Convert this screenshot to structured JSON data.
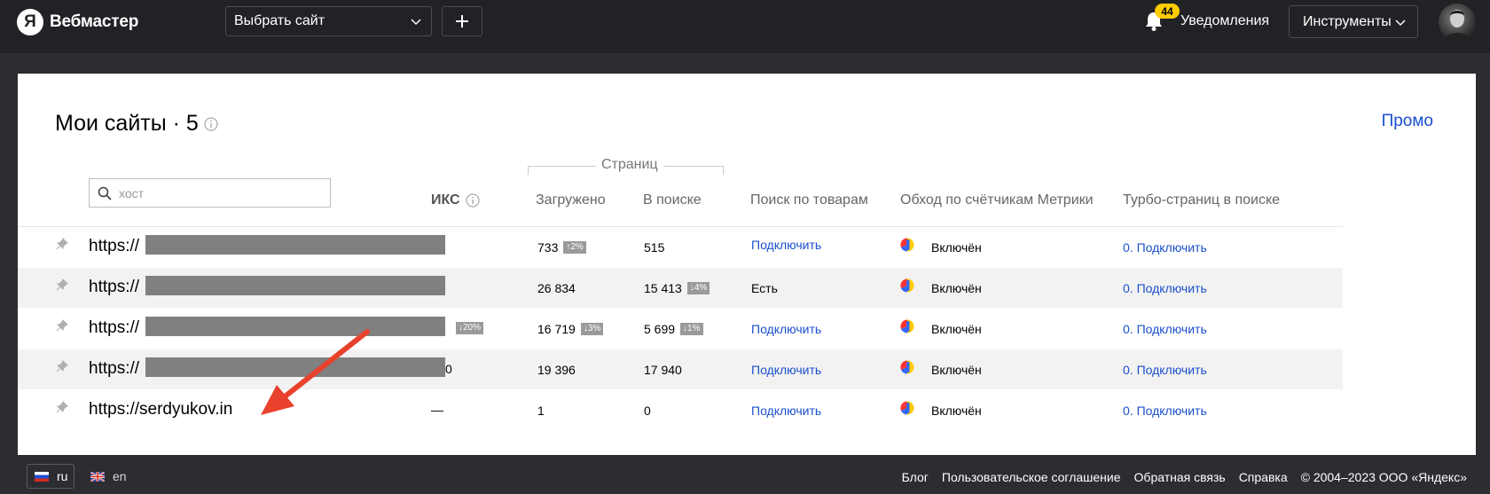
{
  "header": {
    "logo_letter": "Я",
    "logo_text": "Вебмастер",
    "site_select": "Выбрать сайт",
    "notif_count": "44",
    "notif_label": "Уведомления",
    "tools_label": "Инструменты"
  },
  "main": {
    "title": "Мои сайты · 5",
    "promo": "Промо",
    "search_placeholder": "хост",
    "group_label": "Страниц",
    "columns": {
      "iks": "ИКС",
      "loaded": "Загружено",
      "in_search": "В поиске",
      "goods": "Поиск по товарам",
      "metrika": "Обход по счётчикам Метрики",
      "turbo": "Турбо-страниц в поиске"
    },
    "rows": [
      {
        "host": "https://",
        "iks": "",
        "iks_delta": "",
        "loaded": "733",
        "loaded_delta": "↑2%",
        "in_search": "515",
        "search_delta": "",
        "goods": "Подключить",
        "goods_link": true,
        "metrika": "Включён",
        "turbo": "0. Подключить"
      },
      {
        "host": "https://",
        "iks": "",
        "iks_delta": "",
        "loaded": "26 834",
        "loaded_delta": "",
        "in_search": "15 413",
        "search_delta": "↓4%",
        "goods": "Есть",
        "goods_link": false,
        "metrika": "Включён",
        "turbo": "0. Подключить"
      },
      {
        "host": "https://",
        "iks": "",
        "iks_delta": "↓20%",
        "loaded": "16 719",
        "loaded_delta": "↓3%",
        "in_search": "5 699",
        "search_delta": "↓1%",
        "goods": "Подключить",
        "goods_link": true,
        "metrika": "Включён",
        "turbo": "0. Подключить"
      },
      {
        "host": "https://",
        "iks": "0",
        "iks_delta": "",
        "loaded": "19 396",
        "loaded_delta": "",
        "in_search": "17 940",
        "search_delta": "",
        "goods": "Подключить",
        "goods_link": true,
        "metrika": "Включён",
        "turbo": "0. Подключить"
      },
      {
        "host": "https://serdyukov.in",
        "iks": "—",
        "iks_delta": "",
        "loaded": "1",
        "loaded_delta": "",
        "in_search": "0",
        "search_delta": "",
        "goods": "Подключить",
        "goods_link": true,
        "metrika": "Включён",
        "turbo": "0. Подключить"
      }
    ]
  },
  "footer": {
    "lang_ru": "ru",
    "lang_en": "en",
    "links": [
      "Блог",
      "Пользовательское соглашение",
      "Обратная связь",
      "Справка",
      "© 2004–2023 ООО «Яндекс»"
    ]
  },
  "colors": {
    "topbar": "#212226",
    "background": "#2b2d31",
    "link": "#1a4fcc",
    "badge": "#ffcc00",
    "arrow": "#e8412c"
  }
}
